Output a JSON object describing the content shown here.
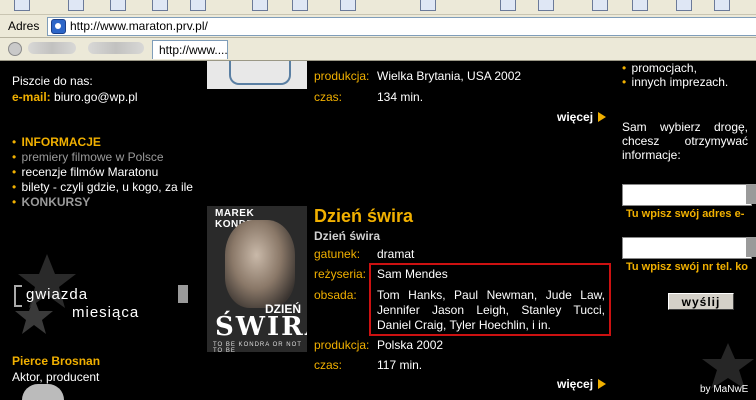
{
  "browser": {
    "address_label": "Adres",
    "url": "http://www.maraton.prv.pl/",
    "active_tab": "http://www...."
  },
  "left": {
    "write_to": "Piszcie do nas:",
    "email_label": "e-mail:",
    "email_value": "biuro.go@wp.pl",
    "menu": [
      {
        "label": "INFORMACJE"
      },
      {
        "label": "premiery filmowe w Polsce"
      },
      {
        "label": "recenzje filmów Maratonu"
      },
      {
        "label": "bilety - czyli gdzie, u kogo, za ile"
      },
      {
        "label": "KONKURSY"
      }
    ],
    "gwiazda_line1": "gwiazda",
    "gwiazda_line2": "miesiąca",
    "star_name": "Pierce Brosnan",
    "star_role": "Aktor, producent"
  },
  "film1": {
    "produkcja_label": "produkcja:",
    "produkcja_value": "Wielka Brytania, USA 2002",
    "czas_label": "czas:",
    "czas_value": "134 min.",
    "more": "więcej"
  },
  "film2": {
    "poster_actor": "MAREK KONDRAT",
    "poster_small": "DZIEŃ",
    "poster_big": "ŚWIRA",
    "poster_tagline": "TO BE KONDRA OR NOT TO BE",
    "title": "Dzień świra",
    "subtitle": "Dzień świra",
    "gatunek_label": "gatunek:",
    "gatunek_value": "dramat",
    "rezyseria_label": "reżyseria:",
    "rezyseria_value": "Sam Mendes",
    "obsada_label": "obsada:",
    "obsada_value": "Tom Hanks, Paul Newman, Jude Law, Jennifer Jason Leigh, Stanley Tucci, Daniel Craig, Tyler Hoechlin, i in.",
    "produkcja_label": "produkcja:",
    "produkcja_value": "Polska 2002",
    "czas_label": "czas:",
    "czas_value": "117 min.",
    "more": "więcej"
  },
  "right": {
    "promo1": "promocjach,",
    "promo2": "innych imprezach.",
    "sam_text": "Sam wybierz drogę, chcesz otrzymywać informacje:",
    "email_hint": "Tu wpisz swój adres e-",
    "phone_hint": "Tu wpisz swój nr tel. ko",
    "send_label": "wyślij",
    "credit": "by MaNwE"
  }
}
